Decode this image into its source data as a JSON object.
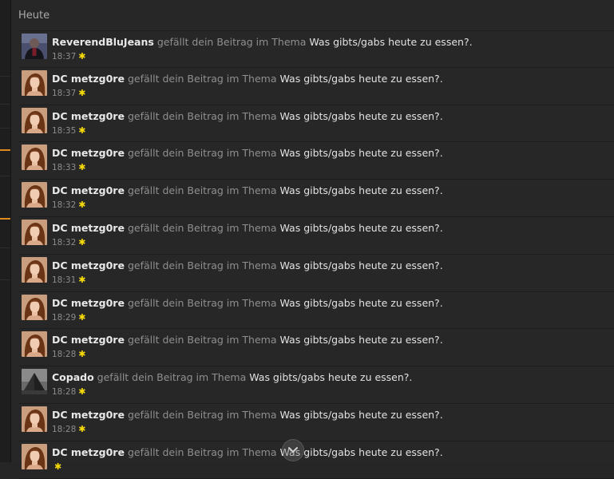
{
  "header": {
    "title": "Heute"
  },
  "notifications": [
    {
      "user": "ReverendBluJeans",
      "avatar": "dark-figure-avatar-icon",
      "action": "gefällt dein Beitrag im Thema",
      "thread": "Was gibts/gabs heute zu essen?.",
      "time": "18:37"
    },
    {
      "user": "DC metzg0re",
      "avatar": "woman-portrait-avatar-icon",
      "action": "gefällt dein Beitrag im Thema",
      "thread": "Was gibts/gabs heute zu essen?.",
      "time": "18:37"
    },
    {
      "user": "DC metzg0re",
      "avatar": "woman-portrait-avatar-icon",
      "action": "gefällt dein Beitrag im Thema",
      "thread": "Was gibts/gabs heute zu essen?.",
      "time": "18:35"
    },
    {
      "user": "DC metzg0re",
      "avatar": "woman-portrait-avatar-icon",
      "action": "gefällt dein Beitrag im Thema",
      "thread": "Was gibts/gabs heute zu essen?.",
      "time": "18:33"
    },
    {
      "user": "DC metzg0re",
      "avatar": "woman-portrait-avatar-icon",
      "action": "gefällt dein Beitrag im Thema",
      "thread": "Was gibts/gabs heute zu essen?.",
      "time": "18:32"
    },
    {
      "user": "DC metzg0re",
      "avatar": "woman-portrait-avatar-icon",
      "action": "gefällt dein Beitrag im Thema",
      "thread": "Was gibts/gabs heute zu essen?.",
      "time": "18:32"
    },
    {
      "user": "DC metzg0re",
      "avatar": "woman-portrait-avatar-icon",
      "action": "gefällt dein Beitrag im Thema",
      "thread": "Was gibts/gabs heute zu essen?.",
      "time": "18:31"
    },
    {
      "user": "DC metzg0re",
      "avatar": "woman-portrait-avatar-icon",
      "action": "gefällt dein Beitrag im Thema",
      "thread": "Was gibts/gabs heute zu essen?.",
      "time": "18:29"
    },
    {
      "user": "DC metzg0re",
      "avatar": "woman-portrait-avatar-icon",
      "action": "gefällt dein Beitrag im Thema",
      "thread": "Was gibts/gabs heute zu essen?.",
      "time": "18:28"
    },
    {
      "user": "Copado",
      "avatar": "pyramid-avatar-icon",
      "action": "gefällt dein Beitrag im Thema",
      "thread": "Was gibts/gabs heute zu essen?.",
      "time": "18:28"
    },
    {
      "user": "DC metzg0re",
      "avatar": "woman-portrait-avatar-icon",
      "action": "gefällt dein Beitrag im Thema",
      "thread": "Was gibts/gabs heute zu essen?.",
      "time": "18:28"
    },
    {
      "user": "DC metzg0re",
      "avatar": "woman-portrait-avatar-icon",
      "action": "gefällt dein Beitrag im Thema",
      "thread": "Was gibts/gabs heute zu essen?.",
      "time": ""
    }
  ],
  "star_icon": "star-icon",
  "colors": {
    "background": "#272727",
    "accent": "#e08a1e",
    "star": "#f5d90a",
    "username": "#e8e8e8",
    "muted": "#8f8f8f"
  },
  "scroll_button": {
    "icon": "chevron-down-icon"
  }
}
